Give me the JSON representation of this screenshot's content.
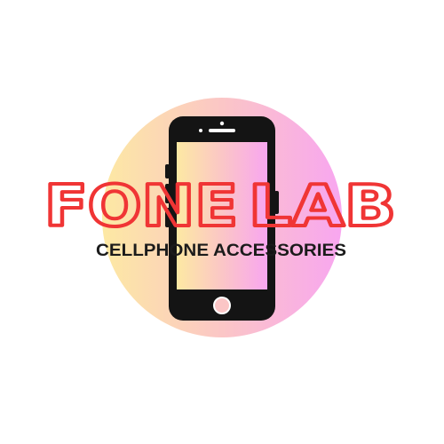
{
  "logo": {
    "brand_word_1": "FONE",
    "brand_word_2": "LAB",
    "tagline": "CELLPHONE ACCESSORIES",
    "icon": "smartphone-icon"
  },
  "colors": {
    "brand_red": "#f03535",
    "tagline_dark": "#1b1b1b",
    "phone_black": "#141414",
    "circle_gradient": [
      "#fde9a3",
      "#fbc6c6",
      "#f8a6f0"
    ],
    "screen_gradient": [
      "#fde9a3",
      "#fbc6c6",
      "#f8a6f0"
    ]
  }
}
